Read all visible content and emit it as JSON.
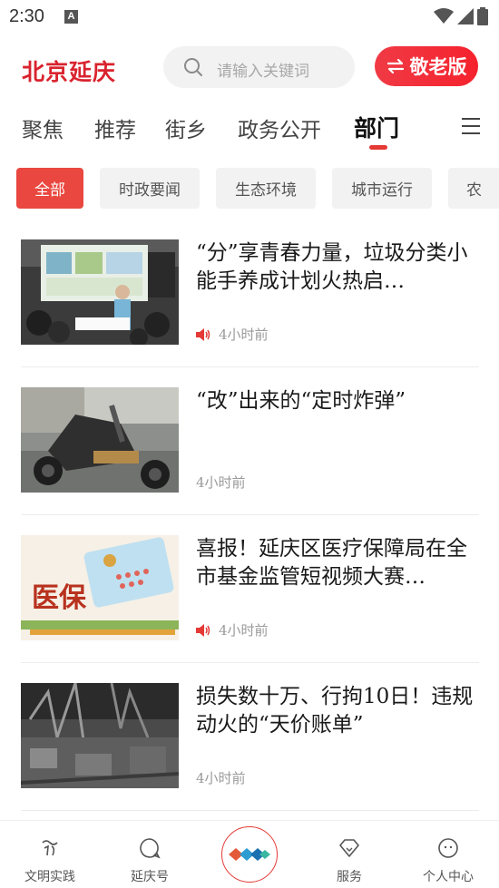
{
  "status_bar": {
    "time": "2:30",
    "notification_icon": "A"
  },
  "header": {
    "logo_text": "北京延庆",
    "search_placeholder": "请输入关键词",
    "elder_mode_label": "敬老版"
  },
  "nav": {
    "items": [
      "聚焦",
      "推荐",
      "街乡",
      "政务公开",
      "部门"
    ],
    "active_index": 4
  },
  "chips": {
    "items": [
      "全部",
      "时政要闻",
      "生态环境",
      "城市运行",
      "农"
    ],
    "active_index": 0
  },
  "articles": [
    {
      "title": "“分”享青春力量，垃圾分类小能手养成计划火热启…",
      "time": "4小时前",
      "has_audio": true
    },
    {
      "title": "“改”出来的“定时炸弹”",
      "time": "4小时前",
      "has_audio": false
    },
    {
      "title": "喜报！延庆区医疗保障局在全市基金监管短视频大赛…",
      "time": "4小时前",
      "has_audio": true,
      "thumb_text": "医保"
    },
    {
      "title": "损失数十万、行拘10日！违规动火的“天价账单”",
      "time": "4小时前",
      "has_audio": false
    }
  ],
  "bottom_nav": {
    "tabs": [
      "文明实践",
      "延庆号",
      "",
      "服务",
      "个人中心"
    ]
  },
  "colors": {
    "accent": "#e53935",
    "chip_active": "#e9473f"
  }
}
